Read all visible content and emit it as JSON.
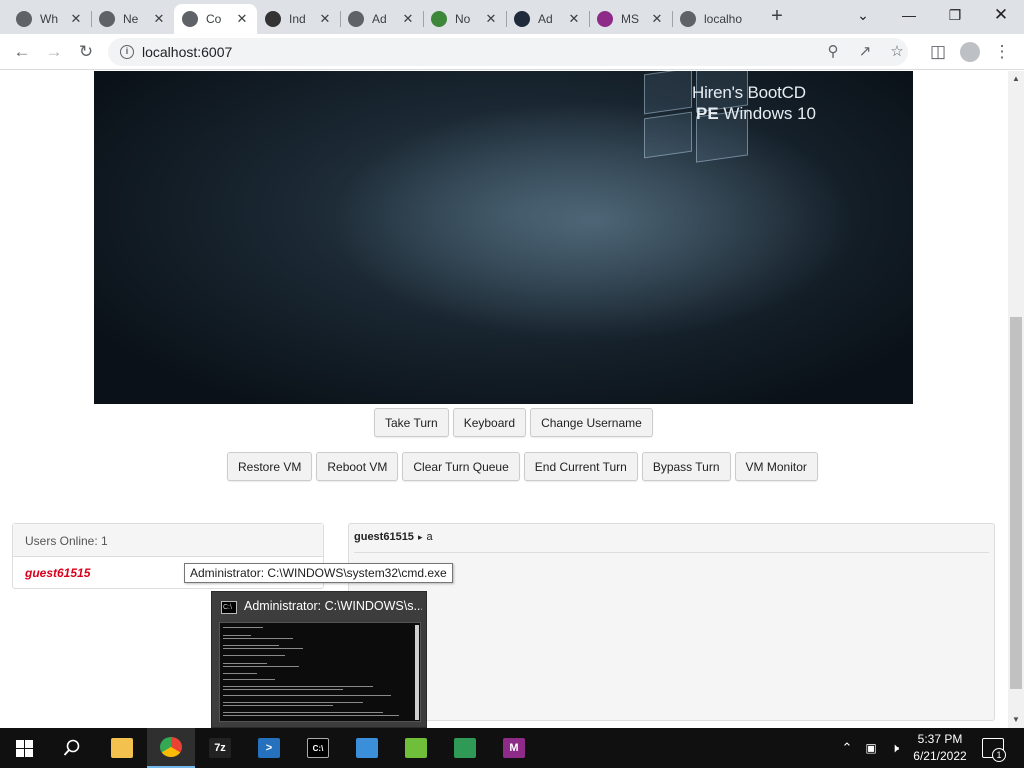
{
  "browser": {
    "tabs": [
      {
        "title": "Wh",
        "favicon": "chrome-icon",
        "color": "#5f6368"
      },
      {
        "title": "Ne",
        "favicon": "chrome-icon",
        "color": "#5f6368"
      },
      {
        "title": "Co",
        "favicon": "globe-icon",
        "color": "#5f6368",
        "active": true
      },
      {
        "title": "Ind",
        "favicon": "github-icon",
        "color": "#333333"
      },
      {
        "title": "Ad",
        "favicon": "globe-icon",
        "color": "#5f6368"
      },
      {
        "title": "No",
        "favicon": "nodejs-icon",
        "color": "#3c873a"
      },
      {
        "title": "Ad",
        "favicon": "hfs-icon",
        "color": "#1f2b3a"
      },
      {
        "title": "MS",
        "favicon": "msys-icon",
        "color": "#8e2a87"
      },
      {
        "title": "localho",
        "favicon": "globe-icon",
        "color": "#5f6368"
      }
    ],
    "url": "localhost:6007"
  },
  "vm": {
    "screen_title_line1": "Hiren's BootCD",
    "screen_title_bold": "PE",
    "screen_title_line2": " Windows 10",
    "row1_buttons": [
      "Take Turn",
      "Keyboard",
      "Change Username"
    ],
    "row2_buttons": [
      "Restore VM",
      "Reboot VM",
      "Clear Turn Queue",
      "End Current Turn",
      "Bypass Turn",
      "VM Monitor"
    ]
  },
  "users": {
    "header": "Users Online: 1",
    "list": [
      "guest61515"
    ],
    "user_color": "#d9001b"
  },
  "chat": {
    "messages": [
      {
        "user": "guest61515",
        "separator": "▸",
        "text": "a"
      }
    ]
  },
  "tooltip": {
    "text": "Administrator: C:\\WINDOWS\\system32\\cmd.exe"
  },
  "thumbnail": {
    "title": "Administrator: C:\\WINDOWS\\s..."
  },
  "taskbar": {
    "apps": [
      {
        "name": "file-explorer-icon",
        "color": "#f2c14e",
        "glyph": ""
      },
      {
        "name": "chrome-icon",
        "color": "#ea4335",
        "glyph": "",
        "active": true
      },
      {
        "name": "7zip-icon",
        "color": "#222222",
        "glyph": "7z"
      },
      {
        "name": "powershell-icon",
        "color": "#2671be",
        "glyph": ">"
      },
      {
        "name": "cmd-icon",
        "color": "#000000",
        "glyph": "C:\\"
      },
      {
        "name": "network-app-icon",
        "color": "#3a8fd8",
        "glyph": ""
      },
      {
        "name": "notepad-plus-icon",
        "color": "#6fbf3b",
        "glyph": ""
      },
      {
        "name": "spreadsheet-icon",
        "color": "#2e9a55",
        "glyph": ""
      },
      {
        "name": "msys2-icon",
        "color": "#8e2a87",
        "glyph": "M"
      }
    ],
    "time": "5:37 PM",
    "date": "6/21/2022",
    "notification_count": "1"
  }
}
